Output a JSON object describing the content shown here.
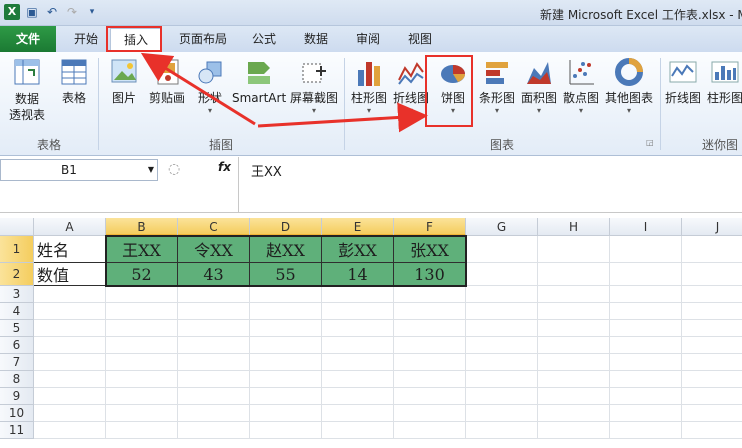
{
  "window": {
    "title": "新建 Microsoft Excel 工作表.xlsx - M"
  },
  "tabs": [
    "文件",
    "开始",
    "插入",
    "页面布局",
    "公式",
    "数据",
    "审阅",
    "视图"
  ],
  "ribbon": {
    "buttons": [
      "数据\n透视表",
      "表格",
      "图片",
      "剪贴画",
      "形状",
      "SmartArt",
      "屏幕截图",
      "柱形图",
      "折线图",
      "饼图",
      "条形图",
      "面积图",
      "散点图",
      "其他图表",
      "折线图",
      "柱形图"
    ],
    "groups": [
      "表格",
      "插图",
      "图表",
      "迷你图"
    ]
  },
  "formula": {
    "name_box": "B1",
    "fx": "fx",
    "content": "王XX"
  },
  "sheet": {
    "columns": [
      "A",
      "B",
      "C",
      "D",
      "E",
      "F",
      "G",
      "H",
      "I",
      "J"
    ],
    "rows": [
      "1",
      "2",
      "3",
      "4",
      "5",
      "6",
      "7",
      "8",
      "9",
      "10",
      "11"
    ],
    "r1": [
      "姓名",
      "王XX",
      "令XX",
      "赵XX",
      "彭XX",
      "张XX"
    ],
    "r2": [
      "数值",
      "52",
      "43",
      "55",
      "14",
      "130"
    ]
  },
  "colors": {
    "accent": "#e8312a",
    "data_fill": "#5fb07a",
    "file_tab": "#1b7a33"
  }
}
